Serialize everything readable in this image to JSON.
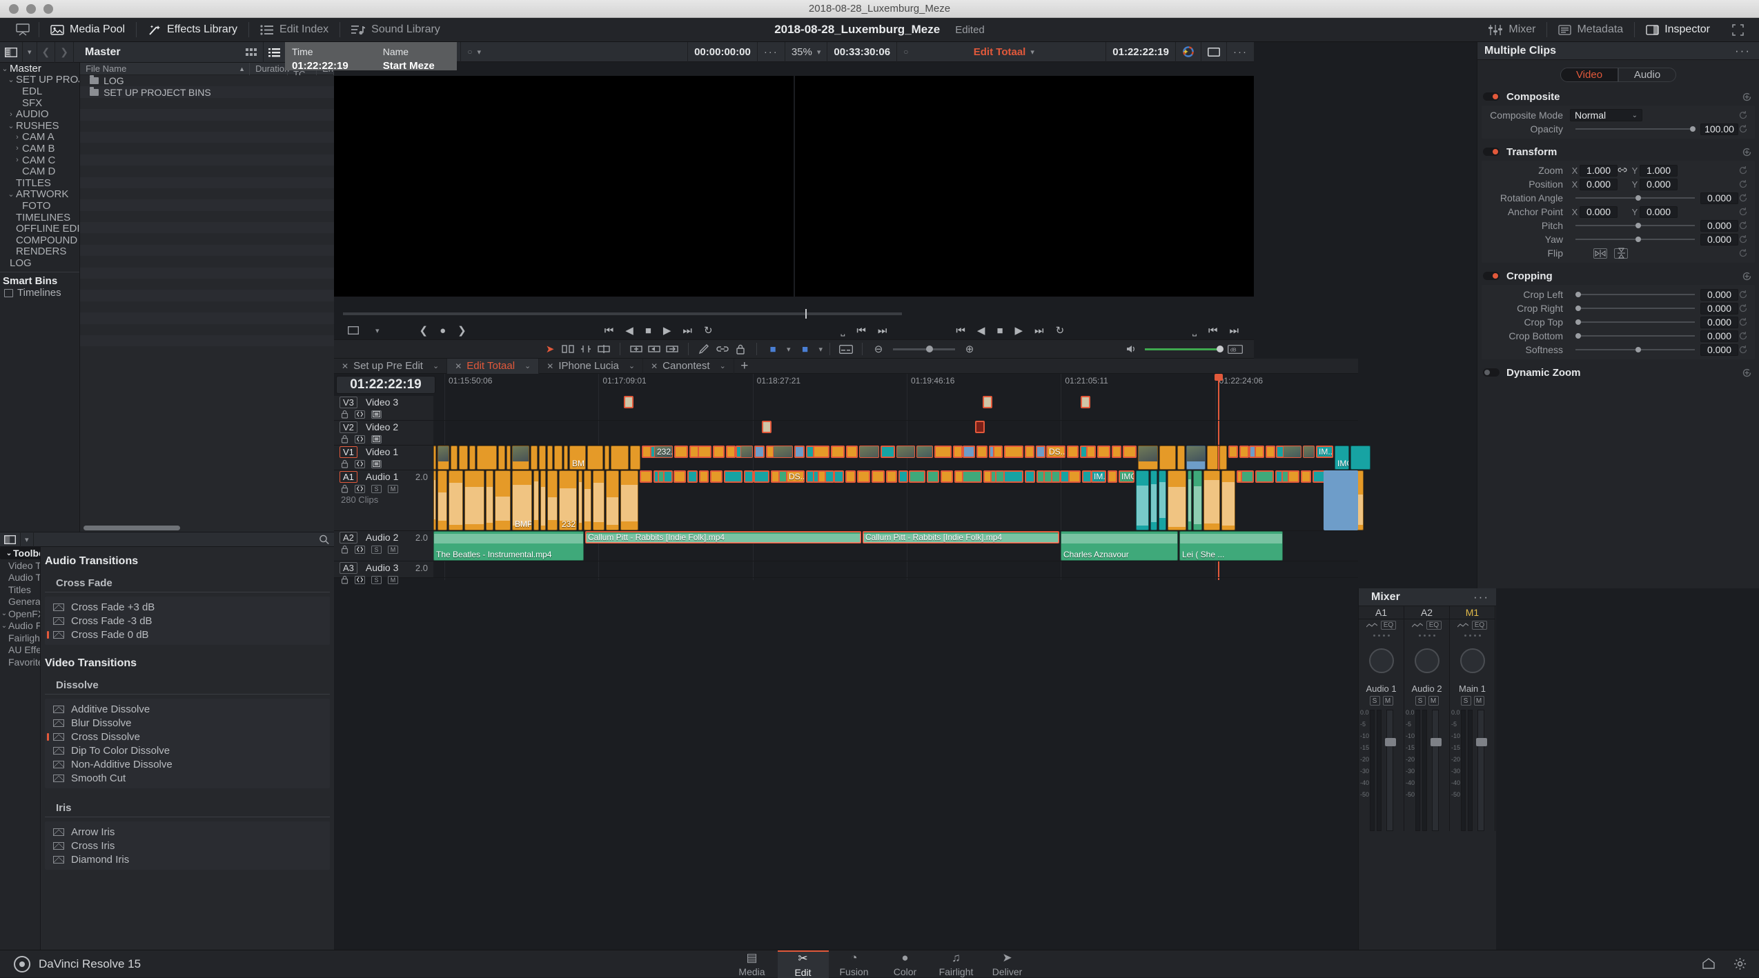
{
  "window": {
    "title": "2018-08-28_Luxemburg_Meze"
  },
  "toolbar": {
    "items": [
      {
        "label": "Media Pool",
        "icon": "media-pool-icon",
        "active": true
      },
      {
        "label": "Effects Library",
        "icon": "effects-library-icon",
        "active": true
      },
      {
        "label": "Edit Index",
        "icon": "edit-index-icon",
        "active": false
      },
      {
        "label": "Sound Library",
        "icon": "sound-library-icon",
        "active": false
      }
    ],
    "right_items": [
      {
        "label": "Mixer",
        "icon": "mixer-icon"
      },
      {
        "label": "Metadata",
        "icon": "metadata-icon"
      },
      {
        "label": "Inspector",
        "icon": "inspector-icon"
      }
    ],
    "fullscreen_icon": "fullscreen-icon"
  },
  "project": {
    "name": "2018-08-28_Luxemburg_Meze",
    "status": "Edited"
  },
  "media_pool": {
    "breadcrumb": "Master",
    "view_icons": [
      "grid-view-icon",
      "list-view-icon",
      "search-icon",
      "options-icon"
    ],
    "zoom": "35%",
    "timecode": "00:00:00:00",
    "columns": [
      "File Name",
      "Duration",
      "Start TC",
      "En"
    ],
    "items": [
      {
        "name": "LOG",
        "icon": "folder-icon"
      },
      {
        "name": "SET UP PROJECT BINS",
        "icon": "folder-icon"
      }
    ]
  },
  "bins": {
    "root": "Master",
    "tree": [
      {
        "label": "Master",
        "depth": 0,
        "twisty": "down",
        "root": true
      },
      {
        "label": "SET UP PROJECT BINS",
        "depth": 1,
        "twisty": "down"
      },
      {
        "label": "EDL",
        "depth": 2,
        "twisty": ""
      },
      {
        "label": "SFX",
        "depth": 2,
        "twisty": ""
      },
      {
        "label": "AUDIO",
        "depth": 1,
        "twisty": "right"
      },
      {
        "label": "RUSHES",
        "depth": 1,
        "twisty": "down"
      },
      {
        "label": "CAM A",
        "depth": 2,
        "twisty": "right"
      },
      {
        "label": "CAM B",
        "depth": 2,
        "twisty": "right"
      },
      {
        "label": "CAM C",
        "depth": 2,
        "twisty": "right"
      },
      {
        "label": "CAM D",
        "depth": 2,
        "twisty": ""
      },
      {
        "label": "TITLES",
        "depth": 1,
        "twisty": ""
      },
      {
        "label": "ARTWORK",
        "depth": 1,
        "twisty": "down"
      },
      {
        "label": "FOTO",
        "depth": 2,
        "twisty": ""
      },
      {
        "label": "TIMELINES",
        "depth": 1,
        "twisty": ""
      },
      {
        "label": "OFFLINE EDIT",
        "depth": 1,
        "twisty": ""
      },
      {
        "label": "COMPOUND CLIPS",
        "depth": 1,
        "twisty": ""
      },
      {
        "label": "RENDERS",
        "depth": 1,
        "twisty": ""
      },
      {
        "label": "LOG",
        "depth": 0,
        "twisty": ""
      }
    ],
    "smart_bins_header": "Smart Bins",
    "smart_bins": [
      {
        "label": "Timelines",
        "icon": "smart-bin-icon"
      }
    ]
  },
  "effects_library": {
    "nav": [
      {
        "label": "Toolbox",
        "twisty": "down",
        "selected": true
      },
      {
        "label": "Video Tr...",
        "twisty": ""
      },
      {
        "label": "Audio Tr...",
        "twisty": ""
      },
      {
        "label": "Titles",
        "twisty": ""
      },
      {
        "label": "Generat...",
        "twisty": ""
      },
      {
        "label": "OpenFX",
        "twisty": "down"
      },
      {
        "label": "Audio FX",
        "twisty": "down"
      },
      {
        "label": "FairlightFX",
        "twisty": ""
      },
      {
        "label": "AU Effects",
        "twisty": ""
      },
      {
        "label": "Favorites",
        "twisty": ""
      }
    ],
    "sections": [
      {
        "title": "Audio Transitions",
        "groups": [
          {
            "name": "Cross Fade",
            "items": [
              {
                "label": "Cross Fade +3 dB",
                "fav": false
              },
              {
                "label": "Cross Fade -3 dB",
                "fav": false
              },
              {
                "label": "Cross Fade 0 dB",
                "fav": true
              }
            ]
          }
        ]
      },
      {
        "title": "Video Transitions",
        "groups": [
          {
            "name": "Dissolve",
            "items": [
              {
                "label": "Additive Dissolve",
                "fav": false
              },
              {
                "label": "Blur Dissolve",
                "fav": false
              },
              {
                "label": "Cross Dissolve",
                "fav": true
              },
              {
                "label": "Dip To Color Dissolve",
                "fav": false
              },
              {
                "label": "Non-Additive Dissolve",
                "fav": false
              },
              {
                "label": "Smooth Cut",
                "fav": false
              }
            ]
          },
          {
            "name": "Iris",
            "items": [
              {
                "label": "Arrow Iris",
                "fav": false
              },
              {
                "label": "Cross Iris",
                "fav": false
              },
              {
                "label": "Diamond Iris",
                "fav": false
              }
            ]
          }
        ]
      }
    ]
  },
  "viewer": {
    "source": {
      "zoom": "35%",
      "timecode_left": "00:00:00:00",
      "timecode_right": "00:00:00:00",
      "options_icon": "options-icon"
    },
    "timeline": {
      "zoom": "35%",
      "duration": "00:33:30:06",
      "name": "Edit Totaal",
      "timecode": "01:22:22:19",
      "color_icon": "color-wheel-icon",
      "frame_icon": "frame-icon",
      "options_icon": "options-icon"
    },
    "overlay": {
      "time_label": "Time",
      "name_label": "Name",
      "time_value": "01:22:22:19",
      "name_value": "Start Meze"
    },
    "transport_left": [
      "jump-start-icon",
      "play-reverse-icon",
      "stop-icon",
      "play-icon",
      "jump-end-icon",
      "loop-icon"
    ],
    "transport_right": [
      "jump-start-icon",
      "play-reverse-icon",
      "stop-icon",
      "play-icon",
      "jump-end-icon",
      "loop-icon"
    ]
  },
  "edit_toolbar": {
    "tools": [
      "pointer-icon",
      "trim-icon",
      "blade-icon",
      "razor-icon",
      "snap-icon",
      "insert-icon",
      "overwrite-icon",
      "replace-icon",
      "pen-icon",
      "link-icon",
      "lock-icon",
      "marker-icon",
      "flag-icon",
      "subtitle-icon"
    ],
    "zoom_controls": [
      "zoom-out-icon",
      "zoom-slider",
      "zoom-in-icon"
    ],
    "right": [
      "audio-icon",
      "volume-slider",
      "mute-icon"
    ]
  },
  "timeline_tabs": {
    "tabs": [
      {
        "label": "Set up Pre Edit",
        "active": false
      },
      {
        "label": "Edit Totaal",
        "active": true
      },
      {
        "label": "IPhone Lucia",
        "active": false
      },
      {
        "label": "Canontest",
        "active": false
      }
    ],
    "add_label": "+"
  },
  "timeline": {
    "playhead_timecode": "01:22:22:19",
    "ruler_ticks": [
      "01:15:50:06",
      "01:17:09:01",
      "01:18:27:21",
      "01:19:46:16",
      "01:21:05:11",
      "01:22:24:06"
    ],
    "tracks": [
      {
        "id": "V3",
        "name": "Video 3",
        "type": "video",
        "channels": ""
      },
      {
        "id": "V2",
        "name": "Video 2",
        "type": "video",
        "channels": ""
      },
      {
        "id": "V1",
        "name": "Video 1",
        "type": "video",
        "channels": "",
        "enabled": true
      },
      {
        "id": "A1",
        "name": "Audio 1",
        "type": "audio",
        "channels": "2.0",
        "enabled": true,
        "clip_count": "280 Clips"
      },
      {
        "id": "A2",
        "name": "Audio 2",
        "type": "audio",
        "channels": "2.0"
      },
      {
        "id": "A3",
        "name": "Audio 3",
        "type": "audio",
        "channels": "2.0"
      }
    ],
    "video_clip_labels": [
      "BMP...",
      "232...",
      "DS...",
      "IM...",
      "IMG_8...",
      "IM...",
      "IM...",
      "BM..."
    ],
    "audio2_clips": [
      {
        "label": "The Beatles - Instrumental.mp4",
        "selected": false
      },
      {
        "label": "Callum Pitt - Rabbits [Indie Folk].mp4",
        "selected": true
      },
      {
        "label": "Callum Pitt - Rabbits [Indie Folk].mp4",
        "selected": true
      },
      {
        "label": "Charles Aznavour",
        "selected": false
      },
      {
        "label": "Lei   ( She ...",
        "selected": false
      }
    ]
  },
  "mixer": {
    "title": "Mixer",
    "options_icon": "options-icon",
    "channels": [
      {
        "id": "A1",
        "label": "Audio 1",
        "eq": "EQ",
        "main": false,
        "scale": [
          "0.0",
          "-5",
          "-10",
          "-15",
          "-20",
          "-30",
          "-40",
          "-50"
        ]
      },
      {
        "id": "A2",
        "label": "Audio 2",
        "eq": "EQ",
        "main": false,
        "scale": [
          "0.0",
          "-5",
          "-10",
          "-15",
          "-20",
          "-30",
          "-40",
          "-50"
        ]
      },
      {
        "id": "M1",
        "label": "Main 1",
        "eq": "EQ",
        "main": true,
        "scale": [
          "0.0",
          "-5",
          "-10",
          "-15",
          "-20",
          "-30",
          "-40",
          "-50"
        ]
      }
    ],
    "buttons": [
      "S",
      "M"
    ]
  },
  "inspector": {
    "title": "Multiple Clips",
    "options_icon": "options-icon",
    "tabs": [
      {
        "label": "Video",
        "active": true
      },
      {
        "label": "Audio",
        "active": false
      }
    ],
    "sections": [
      {
        "name": "Composite",
        "enabled": true,
        "params": [
          {
            "label": "Composite Mode",
            "type": "select",
            "value": "Normal"
          },
          {
            "label": "Opacity",
            "type": "slider",
            "value": "100.00",
            "knob": 96
          }
        ]
      },
      {
        "name": "Transform",
        "enabled": true,
        "params": [
          {
            "label": "Zoom",
            "type": "xy",
            "x": "1.000",
            "y": "1.000",
            "link": true
          },
          {
            "label": "Position",
            "type": "xy",
            "x": "0.000",
            "y": "0.000"
          },
          {
            "label": "Rotation Angle",
            "type": "slider",
            "value": "0.000",
            "knob": 50
          },
          {
            "label": "Anchor Point",
            "type": "xy",
            "x": "0.000",
            "y": "0.000"
          },
          {
            "label": "Pitch",
            "type": "slider",
            "value": "0.000",
            "knob": 50
          },
          {
            "label": "Yaw",
            "type": "slider",
            "value": "0.000",
            "knob": 50
          },
          {
            "label": "Flip",
            "type": "flip"
          }
        ]
      },
      {
        "name": "Cropping",
        "enabled": true,
        "params": [
          {
            "label": "Crop Left",
            "type": "slider",
            "value": "0.000",
            "knob": 0
          },
          {
            "label": "Crop Right",
            "type": "slider",
            "value": "0.000",
            "knob": 0
          },
          {
            "label": "Crop Top",
            "type": "slider",
            "value": "0.000",
            "knob": 0
          },
          {
            "label": "Crop Bottom",
            "type": "slider",
            "value": "0.000",
            "knob": 0
          },
          {
            "label": "Softness",
            "type": "slider",
            "value": "0.000",
            "knob": 50
          }
        ]
      },
      {
        "name": "Dynamic Zoom",
        "enabled": false,
        "params": []
      }
    ]
  },
  "bottom": {
    "app_name": "DaVinci Resolve 15",
    "pages": [
      {
        "label": "Media",
        "icon": "media-page-icon",
        "active": false
      },
      {
        "label": "Edit",
        "icon": "edit-page-icon",
        "active": true
      },
      {
        "label": "Fusion",
        "icon": "fusion-page-icon",
        "active": false
      },
      {
        "label": "Color",
        "icon": "color-page-icon",
        "active": false
      },
      {
        "label": "Fairlight",
        "icon": "fairlight-page-icon",
        "active": false
      },
      {
        "label": "Deliver",
        "icon": "deliver-page-icon",
        "active": false
      }
    ],
    "right_icons": [
      "home-icon",
      "settings-icon"
    ]
  },
  "colors": {
    "accent": "#e2593b",
    "panel": "#232529",
    "panel_alt": "#26282c",
    "bar": "#2b2e33",
    "clip_video": "#e59a28",
    "clip_audio_green": "#3fa97a",
    "clip_audio_teal": "#17a3a3",
    "clip_blue": "#6e9dc9"
  }
}
